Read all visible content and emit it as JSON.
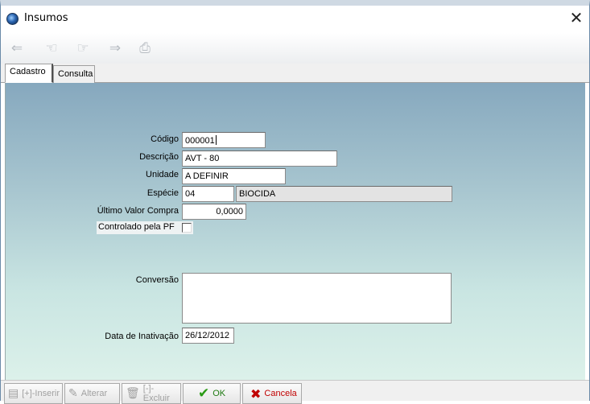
{
  "window": {
    "title": "Insumos",
    "close_glyph": "✕"
  },
  "toolbar": {
    "buttons": [
      {
        "name": "first-record-icon",
        "glyph": "⇐"
      },
      {
        "name": "previous-record-icon",
        "glyph": "☜"
      },
      {
        "name": "next-record-icon",
        "glyph": "☞"
      },
      {
        "name": "last-record-icon",
        "glyph": "⇒"
      },
      {
        "name": "print-icon",
        "glyph": "⎙"
      }
    ]
  },
  "tabs": {
    "cadastro": "Cadastro",
    "consulta": "Consulta"
  },
  "form": {
    "codigo_label": "Código",
    "codigo_value": "000001",
    "descricao_label": "Descrição",
    "descricao_value": "AVT - 80",
    "unidade_label": "Unidade",
    "unidade_value": "A DEFINIR",
    "especie_label": "Espécie",
    "especie_code": "04",
    "especie_desc": "BIOCIDA",
    "ultimo_valor_label": "Último Valor Compra",
    "ultimo_valor_value": "0,0000",
    "controlado_label": "Controlado pela PF",
    "controlado_checked": false,
    "conversao_label": "Conversão",
    "conversao_value": "",
    "data_inativacao_label": "Data de Inativação",
    "data_inativacao_value": "26/12/2012"
  },
  "actions": {
    "inserir": "[+]-Inserir",
    "alterar": "Alterar",
    "excluir": "[-]-Excluir",
    "ok": "OK",
    "cancela": "Cancela"
  },
  "colors": {
    "ok": "#2a9a15",
    "cancel": "#c00000",
    "panel_top": "#86a8be",
    "panel_bottom": "#dcf1ea"
  }
}
